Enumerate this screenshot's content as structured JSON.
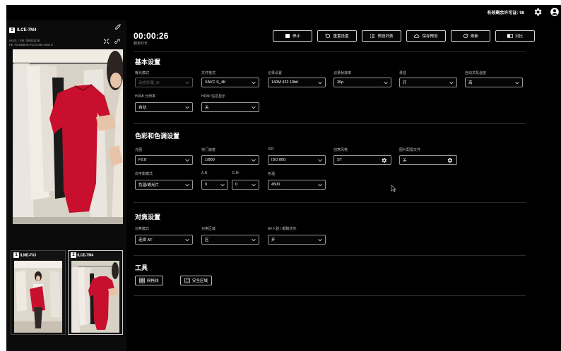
{
  "topbar": {
    "license_label": "有效剩余许可证:",
    "license_count": "98",
    "settings_icon": "gear-icon",
    "account_icon": "user-icon"
  },
  "camera": {
    "number": "2",
    "name": "ILCE-7M4",
    "version_line": "v5.01 / SN: 05083126",
    "lens_line": "FE 70-200mm F2.8 GM OSS II"
  },
  "thumbnails": [
    {
      "number": "1",
      "name": "ILME-FX3",
      "active": false
    },
    {
      "number": "2",
      "name": "ILCE-7M4",
      "active": true
    }
  ],
  "session": {
    "timer": "00:00:26",
    "timer_label": "服务时长"
  },
  "actions": {
    "stop": "停止",
    "reset": "重置设置",
    "preset_list": "预设列表",
    "save_preset": "保存预设",
    "refresh": "刷新",
    "compare": "对比"
  },
  "basic": {
    "title": "基本设置",
    "fields": [
      {
        "label": "曝光模式",
        "value": "动态影像_M",
        "disabled": true
      },
      {
        "label": "文件格式",
        "value": "XAVC S_4K"
      },
      {
        "label": "记录设置",
        "value": "140M 422 10bit"
      },
      {
        "label": "记录帧速率",
        "value": "30p"
      },
      {
        "label": "录音",
        "value": "开"
      },
      {
        "label": "自动关机温度",
        "value": "高"
      },
      {
        "label": "HDMI 分辨率",
        "value": "自动"
      },
      {
        "label": "HDMI 信息显示",
        "value": "关"
      }
    ]
  },
  "color": {
    "title": "色彩和色调设置",
    "fields": [
      {
        "label": "光圈",
        "value": "F2.8"
      },
      {
        "label": "快门速度",
        "value": "1/800"
      },
      {
        "label": "ISO",
        "value": "ISO 800"
      },
      {
        "label": "创意风格",
        "value": "ST"
      },
      {
        "label": "图片配置文件",
        "value": "关"
      },
      {
        "label": "白平衡模式",
        "value": "色温/滤光片"
      },
      {
        "label": "A-B",
        "value": "0"
      },
      {
        "label": "G-M",
        "value": "0"
      },
      {
        "label": "色温",
        "value": "4500"
      }
    ]
  },
  "focus": {
    "title": "对焦设置",
    "fields": [
      {
        "label": "对焦模式",
        "value": "连续 AF"
      },
      {
        "label": "对焦区域",
        "value": "区"
      },
      {
        "label": "AF人脸 / 眼睛优先",
        "value": "开"
      }
    ]
  },
  "tools": {
    "title": "工具",
    "grid": "网格线",
    "safe_area": "安全区域"
  },
  "colors": {
    "background": "#000000",
    "panel": "#0b0b0b",
    "border": "#9a9a9a",
    "dress_red": "#c8102e"
  }
}
